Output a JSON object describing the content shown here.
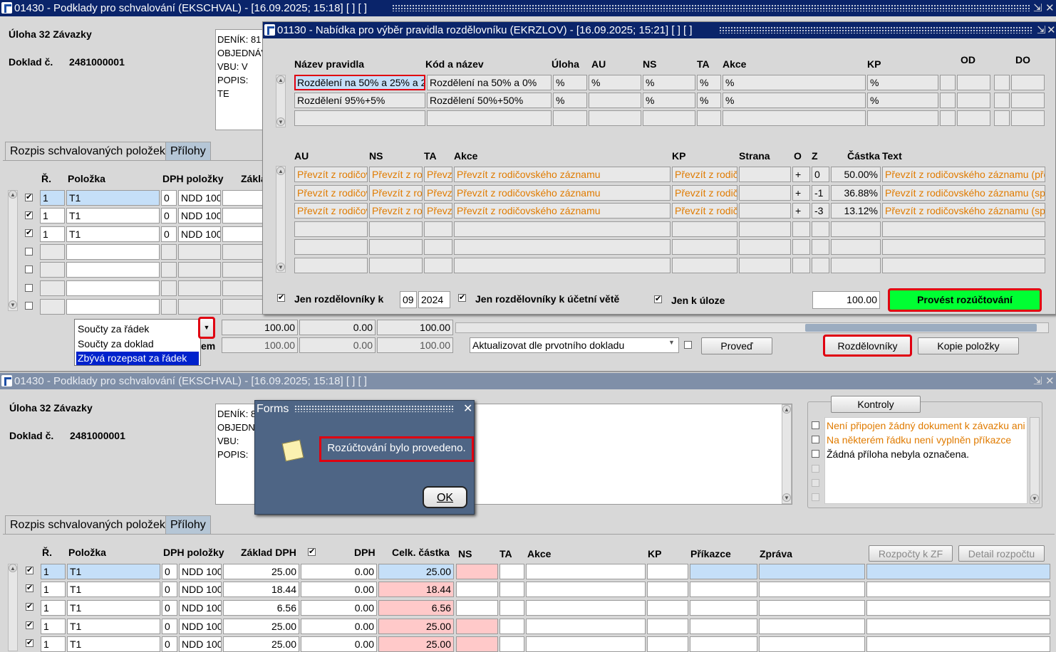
{
  "top_window": {
    "title": "01430 - Podklady pro schvalování (EKSCHVAL) - [16.09.2025; 15:18]  [ ]  [ ]",
    "uloha": "Úloha 32 Závazky",
    "doklad_label": "Doklad č.",
    "doklad_value": "2481000001",
    "popis_lines": [
      "DENÍK: 81",
      "OBJEDNÁV",
      "VBU:      V",
      "POPIS: TE"
    ],
    "tabs": [
      "Rozpis schvalovaných položek",
      "Přílohy"
    ],
    "headers": [
      "Ř.",
      "Položka",
      "DPH položky",
      "Zákla"
    ],
    "rows": [
      [
        "1",
        "T1",
        "0",
        "NDD 100"
      ],
      [
        "1",
        "T1",
        "0",
        "NDD 100"
      ],
      [
        "1",
        "T1",
        "0",
        "NDD 100"
      ]
    ],
    "dropdown_items": [
      "Součty za řádek",
      "Součty za doklad",
      "Zbývá rozepsat za řádek"
    ],
    "sum_row1": [
      "100.00",
      "0.00",
      "100.00"
    ],
    "sum_row2": [
      "100.00",
      "0.00",
      "100.00"
    ],
    "sum_label_suffix": "em",
    "aktualizovat_select": "Aktualizovat dle prvotního dokladu",
    "buttons": {
      "proved": "Proveď",
      "rozdelovniky": "Rozdělovníky",
      "kopie": "Kopie položky"
    }
  },
  "dialog": {
    "title": "01130 - Nabídka pro výběr pravidla rozdělovníku (EKRZLOV) - [16.09.2025; 15:21]  [ ]  [ ]",
    "headers1": [
      "Název pravidla",
      "Kód a název",
      "Úloha",
      "AU",
      "NS",
      "TA",
      "Akce",
      "KP",
      "OD",
      "DO"
    ],
    "rules": [
      [
        "Rozdělení na 50% a 25% a 2",
        "Rozdělení na 50% a 0%",
        "%",
        "%",
        "%",
        "%",
        "%",
        "%"
      ],
      [
        "Rozdělení 95%+5%",
        "Rozdělení 50%+50%",
        "%",
        "",
        "%",
        "%",
        "%",
        "%"
      ]
    ],
    "headers2": [
      "AU",
      "NS",
      "TA",
      "Akce",
      "KP",
      "Strana",
      "O",
      "Z",
      "Částka",
      "Text"
    ],
    "detail_rows": [
      [
        "Převzít z rodičov",
        "Převzít z ro",
        "Převz",
        "Převzít z rodičovského záznamu",
        "Převzít z rodič",
        "",
        "+",
        "0",
        "50.00%",
        "Převzít z rodičovského záznamu (pře"
      ],
      [
        "Převzít z rodičov",
        "Převzít z ro",
        "Převz",
        "Převzít z rodičovského záznamu",
        "Převzít z rodič",
        "",
        "+",
        "-1",
        "36.88%",
        "Převzít z rodičovského záznamu (spo"
      ],
      [
        "Převzít z rodičov",
        "Převzít z ro",
        "Převz",
        "Převzít z rodičovského záznamu",
        "Převzít z rodič",
        "",
        "+",
        "-3",
        "13.12%",
        "Převzít z rodičovského záznamu (spo"
      ]
    ],
    "jen_k": "Jen rozdělovníky k",
    "month": "09",
    "year": "2024",
    "jen_ucetni": "Jen rozdělovníky k účetní větě",
    "jen_uloze": "Jen k úloze",
    "amount": "100.00",
    "provest": "Provést rozúčtování"
  },
  "bottom_window": {
    "title": "01430 - Podklady pro schvalování (EKSCHVAL) - [16.09.2025; 15:18]  [ ]  [ ]",
    "uloha": "Úloha 32 Závazky",
    "doklad_label": "Doklad č.",
    "doklad_value": "2481000001",
    "popis_lines": [
      "DENÍK: 8",
      "OBJEDN",
      "VBU:",
      "POPIS: "
    ],
    "kontroly_title": "Kontroly",
    "kontroly": [
      "Není připojen žádný dokument k závazku ani",
      "Na některém řádku není vyplněn příkazce",
      "Žádná příloha nebyla označena."
    ],
    "tabs": [
      "Rozpis schvalovaných položek",
      "Přílohy"
    ],
    "headers": [
      "Ř.",
      "Položka",
      "DPH položky",
      "Základ DPH",
      "DPH",
      "Celk. částka",
      "NS",
      "TA",
      "Akce",
      "KP",
      "Příkazce",
      "Zpráva"
    ],
    "btn_rozpocty": "Rozpočty k ZF",
    "btn_detail": "Detail rozpočtu",
    "rows": [
      [
        "1",
        "T1",
        "0",
        "NDD 100",
        "25.00",
        "0.00",
        "25.00"
      ],
      [
        "1",
        "T1",
        "0",
        "NDD 100",
        "18.44",
        "0.00",
        "18.44"
      ],
      [
        "1",
        "T1",
        "0",
        "NDD 100",
        "6.56",
        "0.00",
        "6.56"
      ],
      [
        "1",
        "T1",
        "0",
        "NDD 100",
        "25.00",
        "0.00",
        "25.00"
      ],
      [
        "1",
        "T1",
        "0",
        "NDD 100",
        "25.00",
        "0.00",
        "25.00"
      ]
    ]
  },
  "forms_dialog": {
    "title": "Forms",
    "message": "Rozúčtování bylo provedeno.",
    "ok": "OK"
  },
  "colors": {
    "title_active": "#0a246a",
    "title_inactive": "#7f8fa8",
    "accent_red": "#e00010",
    "green": "#00ff33",
    "orange": "#e07b00"
  }
}
